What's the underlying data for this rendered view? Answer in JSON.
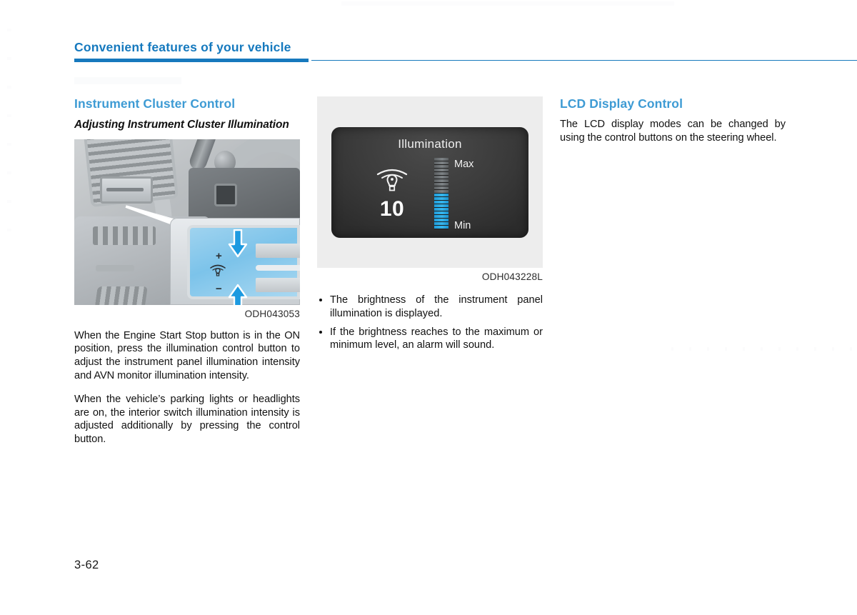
{
  "header": {
    "title": "Convenient features of your vehicle"
  },
  "page_number": "3-62",
  "colors": {
    "header_blue": "#1579BE",
    "rule_blue": "#1779BD",
    "section_heading_blue": "#3E9BD4",
    "lcd_gauge_blue": "#27A8E0",
    "lcd_panel_dark": "#3A3A3A",
    "figure_background": "#EDEDED"
  },
  "column_left": {
    "section_heading": "Instrument Cluster Control",
    "sub_heading": "Adjusting Instrument Cluster Illumination",
    "figure": {
      "caption": "ODH043053",
      "alt": "Dashboard illumination control button with callout showing plus and minus rocker",
      "callout": {
        "plus_label": "+",
        "minus_label": "−",
        "bulb_icon": "illumination-bulb-icon",
        "arrow_down": "arrow-down-icon",
        "arrow_up": "arrow-up-icon"
      }
    },
    "paragraphs": [
      "When the Engine Start Stop button is in the ON position, press the illumination control button to adjust the instrument panel illumination intensity and AVN monitor illumination intensity.",
      "When the vehicle’s parking lights or headlights are on, the interior switch illumination intensity is adjusted additionally by pressing the control button."
    ]
  },
  "column_middle": {
    "figure": {
      "caption": "ODH043228L",
      "lcd": {
        "title": "Illumination",
        "value": "10",
        "icon": "illumination-bulb-icon",
        "gauge_max_label": "Max",
        "gauge_min_label": "Min",
        "gauge_total_segments": 20,
        "gauge_filled_segments": 10
      }
    },
    "bullets": [
      "The brightness of the instrument panel illumination is displayed.",
      "If the brightness reaches to the maximum or minimum level, an alarm will sound."
    ]
  },
  "column_right": {
    "section_heading": "LCD Display Control",
    "paragraphs": [
      "The LCD display modes can be changed by using the control buttons on the steering wheel."
    ]
  }
}
